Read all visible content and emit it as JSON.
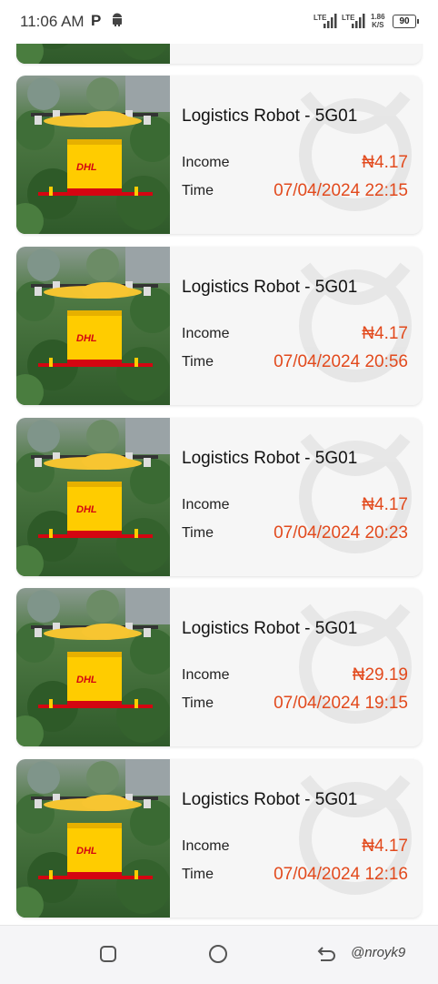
{
  "status_bar": {
    "time": "11:06 AM",
    "app_icon_letter": "P",
    "network_label_1": "LTE",
    "network_label_2": "LTE",
    "net_speed": "1.86",
    "net_unit": "K/S",
    "battery": "90"
  },
  "records": [
    {
      "title": "Logistics Robot - 5G01",
      "income_label": "Income",
      "income": "₦4.17",
      "time_label": "Time",
      "time": "07/04/2024 22:15"
    },
    {
      "title": "Logistics Robot - 5G01",
      "income_label": "Income",
      "income": "₦4.17",
      "time_label": "Time",
      "time": "07/04/2024 20:56"
    },
    {
      "title": "Logistics Robot - 5G01",
      "income_label": "Income",
      "income": "₦4.17",
      "time_label": "Time",
      "time": "07/04/2024 20:23"
    },
    {
      "title": "Logistics Robot - 5G01",
      "income_label": "Income",
      "income": "₦29.19",
      "time_label": "Time",
      "time": "07/04/2024 19:15"
    },
    {
      "title": "Logistics Robot - 5G01",
      "income_label": "Income",
      "income": "₦4.17",
      "time_label": "Time",
      "time": "07/04/2024 12:16"
    }
  ],
  "thumbnail": {
    "brand_text": "DHL"
  },
  "colors": {
    "accent": "#e24a1d",
    "card_bg": "#f6f6f6"
  },
  "navbar": {
    "credit": "@nroyk9"
  }
}
